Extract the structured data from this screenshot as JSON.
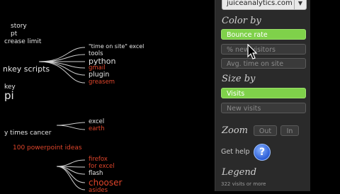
{
  "tree": {
    "left_labels": [
      "story",
      "pt",
      "crease limit",
      "nkey scripts",
      "key",
      "pi",
      "y times cancer",
      "100 powerpoint ideas"
    ],
    "mid_labels": [
      "\"time on site\" excel",
      "tools",
      "python",
      "gmail",
      "plugin",
      "greasem",
      "excel",
      "earth",
      "firefox",
      "for excel",
      "flash",
      "chooser",
      "asides"
    ]
  },
  "panel": {
    "site": "juiceanalytics.com",
    "color_by": {
      "heading": "Color by",
      "options": [
        "Bounce rate",
        "% new visitors",
        "Avg. time on site"
      ],
      "selected": "Bounce rate"
    },
    "size_by": {
      "heading": "Size by",
      "options": [
        "Visits",
        "New visits"
      ],
      "selected": "Visits"
    },
    "zoom": {
      "heading": "Zoom",
      "out": "Out",
      "in": "In"
    },
    "help": {
      "label": "Get help",
      "icon": "?"
    },
    "legend": {
      "heading": "Legend",
      "note": "322 visits or more"
    }
  },
  "colors": {
    "selected": "#7fd14a",
    "panel": "#2a2a2a",
    "accent_red": "#e0452b",
    "text": "#e6e6e6"
  }
}
